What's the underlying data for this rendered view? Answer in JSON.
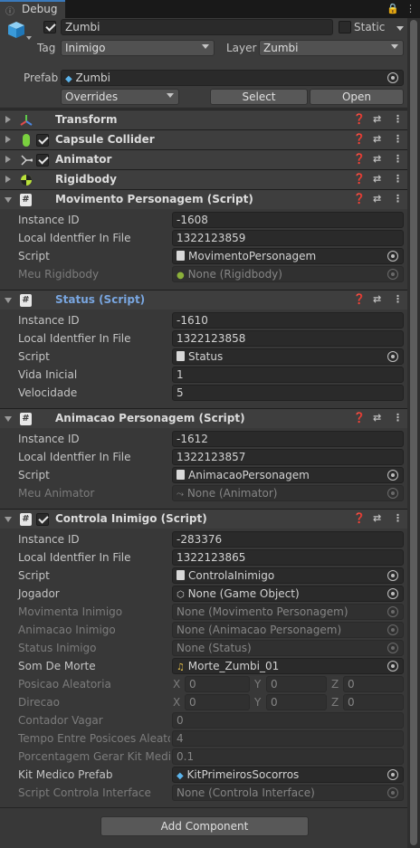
{
  "tab": {
    "label": "Debug"
  },
  "object": {
    "name": "Zumbi",
    "static_label": "Static",
    "tag_label": "Tag",
    "tag_value": "Inimigo",
    "layer_label": "Layer",
    "layer_value": "Zumbi",
    "prefab_label": "Prefab",
    "prefab_value": "Zumbi",
    "overrides_label": "Overrides",
    "select_label": "Select",
    "open_label": "Open"
  },
  "components": {
    "transform": "Transform",
    "capsule": "Capsule Collider",
    "animator": "Animator",
    "rigidbody": "Rigidbody",
    "mov": {
      "title": "Movimento Personagem (Script)",
      "labels": [
        "Instance ID",
        "Local Identfier In File",
        "Script",
        "Meu Rigidbody"
      ],
      "values": [
        "-1608",
        "1322123859",
        "MovimentoPersonagem",
        "None (Rigidbody)"
      ]
    },
    "status": {
      "title": "Status (Script)",
      "labels": [
        "Instance ID",
        "Local Identfier In File",
        "Script",
        "Vida Inicial",
        "Velocidade"
      ],
      "values": [
        "-1610",
        "1322123858",
        "Status",
        "1",
        "5"
      ]
    },
    "anim": {
      "title": "Animacao Personagem (Script)",
      "labels": [
        "Instance ID",
        "Local Identfier In File",
        "Script",
        "Meu Animator"
      ],
      "values": [
        "-1612",
        "1322123857",
        "AnimacaoPersonagem",
        "None (Animator)"
      ]
    },
    "ctrl": {
      "title": "Controla Inimigo (Script)",
      "labels": [
        "Instance ID",
        "Local Identfier In File",
        "Script",
        "Jogador",
        "Movimenta Inimigo",
        "Animacao Inimigo",
        "Status Inimigo",
        "Som De Morte",
        "Posicao Aleatoria",
        "Direcao",
        "Contador Vagar",
        "Tempo Entre Posicoes Aleato",
        "Porcentagem Gerar Kit Medic",
        "Kit Medico Prefab",
        "Script Controla Interface"
      ],
      "values": [
        "-283376",
        "1322123865",
        "ControlaInimigo",
        "None (Game Object)",
        "None (Movimento Personagem)",
        "None (Animacao Personagem)",
        "None (Status)",
        "Morte_Zumbi_01",
        "",
        "",
        "0",
        "4",
        "0.1",
        "KitPrimeirosSocorros",
        "None (Controla Interface)"
      ],
      "vec_labels": [
        "X",
        "Y",
        "Z"
      ],
      "posicao": [
        "0",
        "0",
        "0"
      ],
      "direcao": [
        "0",
        "0",
        "0"
      ]
    }
  },
  "add_component": "Add Component",
  "colors": {
    "bg": "#383838",
    "field": "#2a2a2a",
    "accent": "#3a79bb",
    "selected_title": "#79a6e0"
  }
}
